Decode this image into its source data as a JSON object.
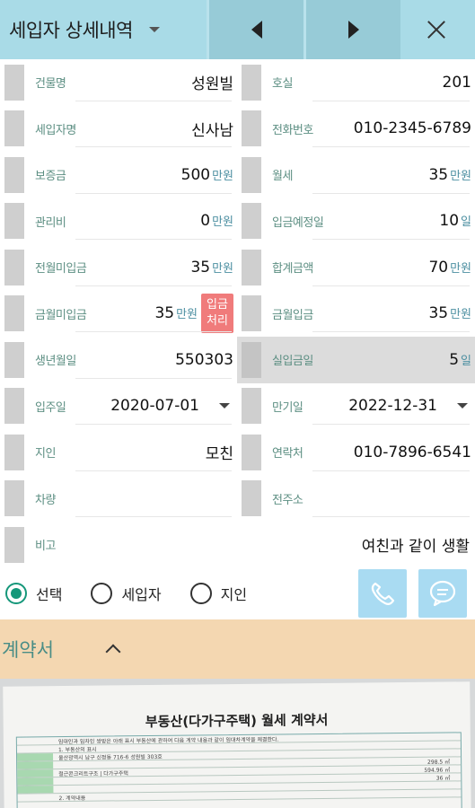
{
  "header": {
    "title": "세입자 상세내역"
  },
  "fields": {
    "building": {
      "label": "건물명",
      "value": "성원빌"
    },
    "unit_no": {
      "label": "호실",
      "value": "201"
    },
    "tenant": {
      "label": "세입자명",
      "value": "신사남"
    },
    "phone": {
      "label": "전화번호",
      "value": "010-2345-6789"
    },
    "deposit": {
      "label": "보증금",
      "value": "500",
      "unit": "만원"
    },
    "rent": {
      "label": "월세",
      "value": "35",
      "unit": "만원"
    },
    "mgmt": {
      "label": "관리비",
      "value": "0",
      "unit": "만원"
    },
    "due_day": {
      "label": "입금예정일",
      "value": "10",
      "unit": "일"
    },
    "prev_unpaid": {
      "label": "전월미입금",
      "value": "35",
      "unit": "만원"
    },
    "total": {
      "label": "합계금액",
      "value": "70",
      "unit": "만원"
    },
    "cur_unpaid": {
      "label": "금월미입금",
      "value": "35",
      "unit": "만원",
      "button_line1": "입금",
      "button_line2": "처리"
    },
    "cur_paid": {
      "label": "금월입금",
      "value": "35",
      "unit": "만원"
    },
    "birth": {
      "label": "생년월일",
      "value": "550303"
    },
    "actual_day": {
      "label": "실입금일",
      "value": "5",
      "unit": "일"
    },
    "move_in": {
      "label": "입주일",
      "value": "2020-07-01"
    },
    "expiry": {
      "label": "만기일",
      "value": "2022-12-31"
    },
    "acquaintance": {
      "label": "지인",
      "value": "모친"
    },
    "contact": {
      "label": "연락처",
      "value": "010-7896-6541"
    },
    "vehicle": {
      "label": "차량",
      "value": ""
    },
    "prev_address": {
      "label": "전주소",
      "value": ""
    },
    "memo": {
      "label": "비고",
      "value": "여친과 같이 생활"
    }
  },
  "radio": {
    "options": [
      "선택",
      "세입자",
      "지인"
    ],
    "selected": "선택"
  },
  "contract": {
    "title": "계약서",
    "doc_title": "부동산(다가구주택) 월세 계약서",
    "doc_lines": [
      "임대인과 임차인 쌍방은 아래 표시 부동산에 관하여 다음 계약 내용과 같이 임대차계약을 체결한다.",
      "1. 부동산의 표시",
      "울산광역시 남구 신정동 716-6 성원빌 303호",
      "철근콘크리트구조 | 다가구주택",
      "2. 계약내용"
    ],
    "doc_values": [
      "298.5 ㎡",
      "594.96 ㎡",
      "36 ㎡"
    ]
  },
  "colors": {
    "header_bg": "#a9dbe7",
    "accent_green": "#15977a",
    "label_color": "#5d8f83",
    "pay_button": "#f07b7b",
    "action_button": "#a9dbf2",
    "contract_bar": "#f4d7b1"
  }
}
